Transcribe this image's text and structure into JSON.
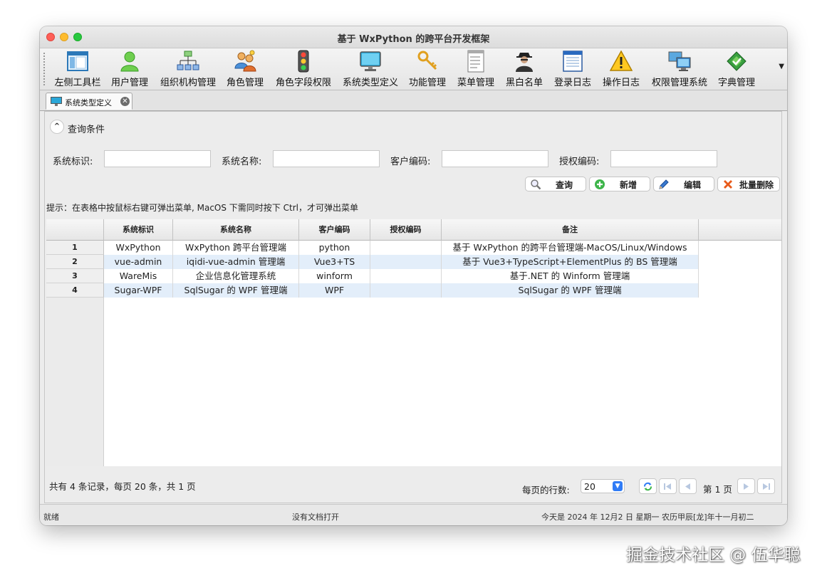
{
  "window": {
    "title": "基于 WxPython 的跨平台开发框架"
  },
  "toolbar": {
    "items": [
      {
        "label": "左侧工具栏",
        "icon": "sidebar-window-icon"
      },
      {
        "label": "用户管理",
        "icon": "user-icon"
      },
      {
        "label": "组织机构管理",
        "icon": "org-chart-icon"
      },
      {
        "label": "角色管理",
        "icon": "role-users-icon"
      },
      {
        "label": "角色字段权限",
        "icon": "traffic-light-icon"
      },
      {
        "label": "系统类型定义",
        "icon": "monitor-icon"
      },
      {
        "label": "功能管理",
        "icon": "keys-icon"
      },
      {
        "label": "菜单管理",
        "icon": "menu-list-icon"
      },
      {
        "label": "黑白名单",
        "icon": "spy-icon"
      },
      {
        "label": "登录日志",
        "icon": "log-document-icon"
      },
      {
        "label": "操作日志",
        "icon": "warning-icon"
      },
      {
        "label": "权限管理系统",
        "icon": "computers-icon"
      },
      {
        "label": "字典管理",
        "icon": "dictionary-book-icon"
      }
    ]
  },
  "tab": {
    "label": "系统类型定义"
  },
  "query": {
    "section_label": "查询条件",
    "fields": [
      {
        "label": "系统标识:",
        "value": ""
      },
      {
        "label": "系统名称:",
        "value": ""
      },
      {
        "label": "客户编码:",
        "value": ""
      },
      {
        "label": "授权编码:",
        "value": ""
      }
    ],
    "buttons": {
      "search": "查询",
      "add": "新增",
      "edit": "编辑",
      "batch_delete": "批量删除"
    }
  },
  "hint": "提示：在表格中按鼠标右键可弹出菜单, MacOS 下需同时按下 Ctrl，才可弹出菜单",
  "table": {
    "columns": [
      "系统标识",
      "系统名称",
      "客户编码",
      "授权编码",
      "备注"
    ],
    "rows": [
      {
        "num": "1",
        "cells": [
          "WxPython",
          "WxPython 跨平台管理端",
          "python",
          "",
          "基于 WxPython 的跨平台管理端-MacOS/Linux/Windows"
        ]
      },
      {
        "num": "2",
        "cells": [
          "vue-admin",
          "iqidi-vue-admin 管理端",
          "Vue3+TS",
          "",
          "基于 Vue3+TypeScript+ElementPlus 的 BS 管理端"
        ]
      },
      {
        "num": "3",
        "cells": [
          "WareMis",
          "企业信息化管理系统",
          "winform",
          "",
          "基于.NET 的 Winform 管理端"
        ]
      },
      {
        "num": "4",
        "cells": [
          "Sugar-WPF",
          "SqlSugar 的 WPF 管理端",
          "WPF",
          "",
          "SqlSugar 的 WPF 管理端"
        ]
      }
    ]
  },
  "pager": {
    "summary": "共有 4 条记录，每页 20 条，共 1 页",
    "page_size_label": "每页的行数:",
    "page_size": "20",
    "page_label": "第 1 页"
  },
  "status": {
    "left": "就绪",
    "center": "没有文档打开",
    "right": "今天是 2024 年 12月2 日 星期一 农历甲辰[龙]年十一月初二"
  },
  "watermark": "掘金技术社区 @ 伍华聪"
}
